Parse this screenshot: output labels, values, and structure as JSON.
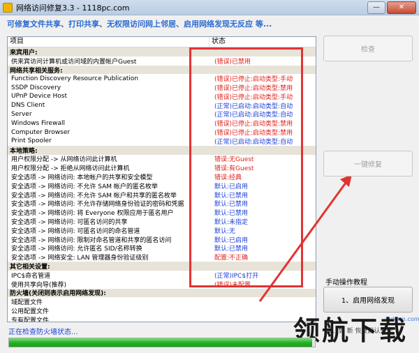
{
  "window": {
    "title": "网络访问修复3.3 - 1118pc.com",
    "min": "—",
    "max": "□",
    "close": "✕"
  },
  "banner": "可修复文件共享、打印共享、无权限访问网上邻居、启用网络发现无反应  等...",
  "list": {
    "headers": {
      "item": "项目",
      "status": "状态"
    },
    "rows": [
      {
        "cat": true,
        "c1": "来宾用户:",
        "c2": ""
      },
      {
        "c1": "供来宾访问计算机或访问域的内置帐户Guest",
        "c2": "(错误)已禁用",
        "s": "err"
      },
      {
        "cat": true,
        "c1": "网络共享相关服务:",
        "c2": ""
      },
      {
        "c1": "Function Discovery Resource Publication",
        "c2": "(错误)已停止:启动类型:手动",
        "s": "err"
      },
      {
        "c1": "SSDP Discovery",
        "c2": "(错误)已停止:启动类型:禁用",
        "s": "err"
      },
      {
        "c1": "UPnP Device Host",
        "c2": "(错误)已停止:启动类型:手动",
        "s": "err"
      },
      {
        "c1": "DNS Client",
        "c2": "(正常)已启动:启动类型:自动",
        "s": "ok"
      },
      {
        "c1": "Server",
        "c2": "(正常)已启动:启动类型:自动",
        "s": "ok"
      },
      {
        "c1": "Windows Firewall",
        "c2": "(错误)已停止:启动类型:禁用",
        "s": "err"
      },
      {
        "c1": "Computer Browser",
        "c2": "(错误)已停止:启动类型:禁用",
        "s": "err"
      },
      {
        "c1": "Print Spooler",
        "c2": "(正常)已启动:启动类型:自动",
        "s": "ok"
      },
      {
        "cat": true,
        "c1": "本地策略:",
        "c2": ""
      },
      {
        "c1": "用户权限分配 -> 从网络访问此计算机",
        "c2": "错误:无Guest",
        "s": "err"
      },
      {
        "c1": "用户权限分配 -> 拒绝从网络访问此计算机",
        "c2": "错误:有Guest",
        "s": "err"
      },
      {
        "c1": "安全选项 -> 网络访问: 本地帐户的共享和安全模型",
        "c2": "错误:经典",
        "s": "err"
      },
      {
        "c1": "安全选项 -> 网络访问: 不允许 SAM 帐户的匿名枚举",
        "c2": "默认:已启用",
        "s": "ok"
      },
      {
        "c1": "安全选项 -> 网络访问: 不允许 SAM 帐户和共享的匿名枚举",
        "c2": "默认:已禁用",
        "s": "ok"
      },
      {
        "c1": "安全选项 -> 网络访问: 不允许存储网络身份验证的密码和凭据",
        "c2": "默认:已禁用",
        "s": "ok"
      },
      {
        "c1": "安全选项 -> 网络访问: 将 Everyone 权限应用于匿名用户",
        "c2": "默认:已禁用",
        "s": "ok"
      },
      {
        "c1": "安全选项 -> 网络访问: 可匿名访问的共享",
        "c2": "默认:未指定",
        "s": "ok"
      },
      {
        "c1": "安全选项 -> 网络访问: 可匿名访问的命名管道",
        "c2": "默认:无",
        "s": "ok"
      },
      {
        "c1": "安全选项 -> 网络访问: 限制对命名管道和共享的匿名访问",
        "c2": "默认:已启用",
        "s": "ok"
      },
      {
        "c1": "安全选项 -> 网络访问: 允许匿名 SID/名称转换",
        "c2": "默认:已禁用",
        "s": "ok"
      },
      {
        "c1": "安全选项 -> 网络安全: LAN 管理器身份验证级别",
        "c2": "配置:不正确",
        "s": "err"
      },
      {
        "cat": true,
        "c1": "其它相关设置:",
        "c2": ""
      },
      {
        "c1": "IPC$命名管道",
        "c2": "(正常)IPC$打开",
        "s": "ok"
      },
      {
        "c1": "使用共享向导(推荐)",
        "c2": "(错误)未配置",
        "s": "err"
      },
      {
        "cat": true,
        "c1": "防火墙(关闭则表示启用网络发现):",
        "c2": ""
      },
      {
        "c1": "域配置文件",
        "c2": ""
      },
      {
        "c1": "公用配置文件",
        "c2": ""
      },
      {
        "c1": "专有配置文件",
        "c2": ""
      }
    ]
  },
  "buttons": {
    "check": "检查",
    "repair": "一键修复",
    "enable_discovery": "1、启用网络发现"
  },
  "tutorial_label": "手动操作教程",
  "hint": "2、如  新   恢复默认开关",
  "status": "正在检查防火墙状态...",
  "progress": 0.99,
  "watermark": {
    "url": "lhdown.com",
    "text": "领航下载"
  },
  "colors": {
    "error": "#e0201a",
    "ok": "#1c3fd6",
    "highlight": "#e23333"
  }
}
